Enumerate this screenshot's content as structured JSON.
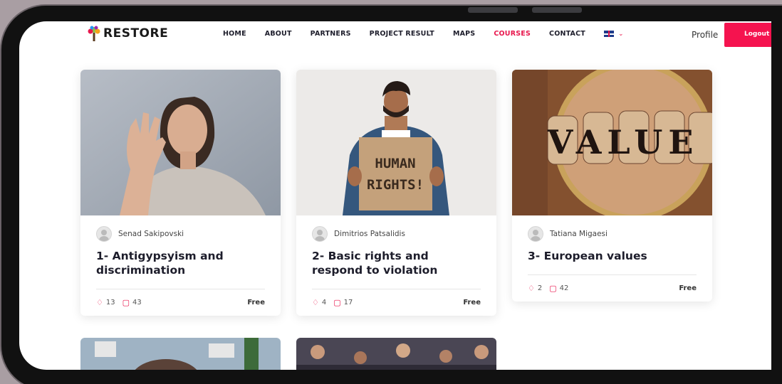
{
  "brand": {
    "name": "RESTORE"
  },
  "nav": {
    "items": [
      {
        "label": "HOME",
        "active": false
      },
      {
        "label": "ABOUT",
        "active": false
      },
      {
        "label": "PARTNERS",
        "active": false
      },
      {
        "label": "PROJECT RESULT",
        "active": false
      },
      {
        "label": "MAPS",
        "active": false
      },
      {
        "label": "COURSES",
        "active": true
      },
      {
        "label": "CONTACT",
        "active": false
      }
    ],
    "language_icon": "uk-flag-icon",
    "profile_label": "Profile",
    "logout_label": "Logout"
  },
  "colors": {
    "accent": "#e8174d",
    "logout": "#f5134f"
  },
  "courses": [
    {
      "author": "Senad Sakipovski",
      "title": "1- Antigypsyism and discrimination",
      "students": "13",
      "lessons": "43",
      "price": "Free"
    },
    {
      "author": "Dimitrios Patsalidis",
      "title": "2- Basic rights and respond to violation",
      "students": "4",
      "lessons": "17",
      "price": "Free"
    },
    {
      "author": "Tatiana Migaesi",
      "title": "3- European values",
      "students": "2",
      "lessons": "42",
      "price": "Free"
    }
  ],
  "sign_text": {
    "line1": "HUMAN",
    "line2": "RIGHTS!"
  },
  "value_text": "VALUE"
}
